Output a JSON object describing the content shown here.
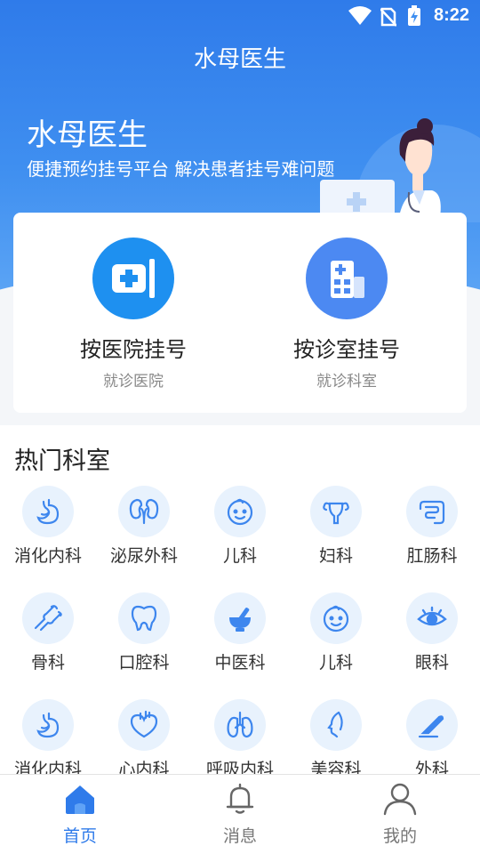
{
  "status_bar": {
    "time": "8:22"
  },
  "app_title": "水母医生",
  "banner": {
    "title": "水母医生",
    "subtitle": "便捷预约挂号平台 解决患者挂号难问题"
  },
  "registration": [
    {
      "label": "按医院挂号",
      "sub": "就诊医院",
      "icon": "hospital-sign-icon"
    },
    {
      "label": "按诊室挂号",
      "sub": "就诊科室",
      "icon": "building-icon"
    }
  ],
  "departments_title": "热门科室",
  "departments": [
    {
      "name": "消化内科",
      "icon": "stomach-icon"
    },
    {
      "name": "泌尿外科",
      "icon": "kidney-icon"
    },
    {
      "name": "儿科",
      "icon": "baby-face-icon"
    },
    {
      "name": "妇科",
      "icon": "uterus-icon"
    },
    {
      "name": "肛肠科",
      "icon": "intestine-icon"
    },
    {
      "name": "骨科",
      "icon": "bone-joint-icon"
    },
    {
      "name": "口腔科",
      "icon": "tooth-icon"
    },
    {
      "name": "中医科",
      "icon": "mortar-icon"
    },
    {
      "name": "儿科",
      "icon": "baby-face-icon"
    },
    {
      "name": "眼科",
      "icon": "eye-icon"
    },
    {
      "name": "消化内科",
      "icon": "stomach-icon"
    },
    {
      "name": "心内科",
      "icon": "heart-icon"
    },
    {
      "name": "呼吸内科",
      "icon": "lungs-icon"
    },
    {
      "name": "美容科",
      "icon": "face-profile-icon"
    },
    {
      "name": "外科",
      "icon": "scalpel-icon"
    }
  ],
  "tabs": [
    {
      "label": "首页",
      "icon": "home-icon",
      "active": true
    },
    {
      "label": "消息",
      "icon": "bell-icon",
      "active": false
    },
    {
      "label": "我的",
      "icon": "user-icon",
      "active": false
    }
  ],
  "colors": {
    "primary": "#2f7bea",
    "icon_bg": "#e8f2fd",
    "icon_stroke": "#3d86ee"
  }
}
